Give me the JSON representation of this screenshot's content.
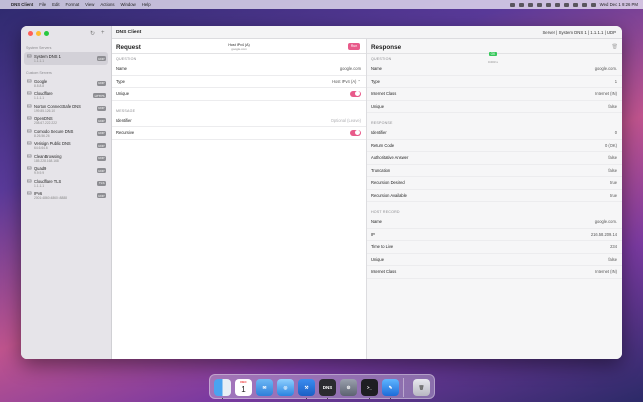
{
  "menubar": {
    "apple": "",
    "app": "DNS Client",
    "items": [
      "File",
      "Edit",
      "Format",
      "View",
      "Actions",
      "Window",
      "Help"
    ],
    "clock": "Wed Dec 1 9:26 PM"
  },
  "window": {
    "title": "DNS Client",
    "server": "Server | System DNS 1 | 1.1.1.1 | UDP"
  },
  "sidebar": {
    "system_title": "System Servers",
    "custom_title": "Custom Servers",
    "system_items": [
      {
        "name": "System DNS 1",
        "address": "1.1.1.1",
        "badge": "UDP"
      }
    ],
    "custom_items": [
      {
        "name": "Google",
        "address": "8.8.8.8",
        "badge": "UDP"
      },
      {
        "name": "Cloudflare",
        "address": "1.1.1.1",
        "badge": "HTTPS"
      },
      {
        "name": "Norton ConnectSafe DNS",
        "address": "199.85.126.10",
        "badge": "UDP"
      },
      {
        "name": "OpenDNS",
        "address": "208.67.222.222",
        "badge": "UDP"
      },
      {
        "name": "Comodo Secure DNS",
        "address": "8.26.56.26",
        "badge": "UDP"
      },
      {
        "name": "Verisign Public DNS",
        "address": "64.6.64.6",
        "badge": "UDP"
      },
      {
        "name": "CleanBrowsing",
        "address": "185.228.168.168",
        "badge": "UDP"
      },
      {
        "name": "Quad9",
        "address": "9.9.9.9",
        "badge": "UDP"
      },
      {
        "name": "Cloudflare TLS",
        "address": "1.1.1.1",
        "badge": "TLS"
      },
      {
        "name": "IPv6",
        "address": "2001:4860:4860::8888",
        "badge": "UDP"
      }
    ]
  },
  "request": {
    "title": "Request",
    "summary_type": "Host IPv4 (A)",
    "summary_name": "google.com",
    "run_label": "Run",
    "question_header": "QUESTION",
    "message_header": "MESSAGE",
    "name_label": "Name",
    "name_value": "google.com",
    "type_label": "Type",
    "type_value": "Host IPv4 (A) ⌃",
    "unique_label": "Unique",
    "identifier_label": "Identifier",
    "identifier_placeholder": "Optional (Leave)",
    "recursive_label": "Recursive"
  },
  "response": {
    "title": "Response",
    "status": "OK",
    "time": "0.003 s",
    "question_header": "QUESTION",
    "question_rows": [
      {
        "k": "Name",
        "v": "google.com."
      },
      {
        "k": "Type",
        "v": "1"
      },
      {
        "k": "Internet Class",
        "v": "Internet (IN)"
      },
      {
        "k": "Unique",
        "v": "false"
      }
    ],
    "response_header": "RESPONSE",
    "response_rows": [
      {
        "k": "Identifier",
        "v": "0"
      },
      {
        "k": "Return Code",
        "v": "0 (OK)"
      },
      {
        "k": "Authoritative Answer",
        "v": "false"
      },
      {
        "k": "Truncation",
        "v": "false"
      },
      {
        "k": "Recursion Desired",
        "v": "true"
      },
      {
        "k": "Recursion Available",
        "v": "true"
      }
    ],
    "host_header": "HOST RECORD",
    "host_rows": [
      {
        "k": "Name",
        "v": "google.com."
      },
      {
        "k": "IP",
        "v": "216.58.209.14"
      },
      {
        "k": "Time to Live",
        "v": "234"
      },
      {
        "k": "Unique",
        "v": "false"
      },
      {
        "k": "Internet Class",
        "v": "Internet (IN)"
      }
    ]
  },
  "dock": {
    "calendar_month": "DEC",
    "calendar_day": "1",
    "dns_label": "DNS",
    "apps": [
      "finder-icon",
      "calendar-icon",
      "mail-icon",
      "safari-icon",
      "xcode-icon",
      "dns-client-icon",
      "system-preferences-icon",
      "terminal-icon",
      "app-icon",
      "trash-icon"
    ]
  },
  "colors": {
    "accent": "#e85a8a",
    "ok": "#34c759"
  }
}
